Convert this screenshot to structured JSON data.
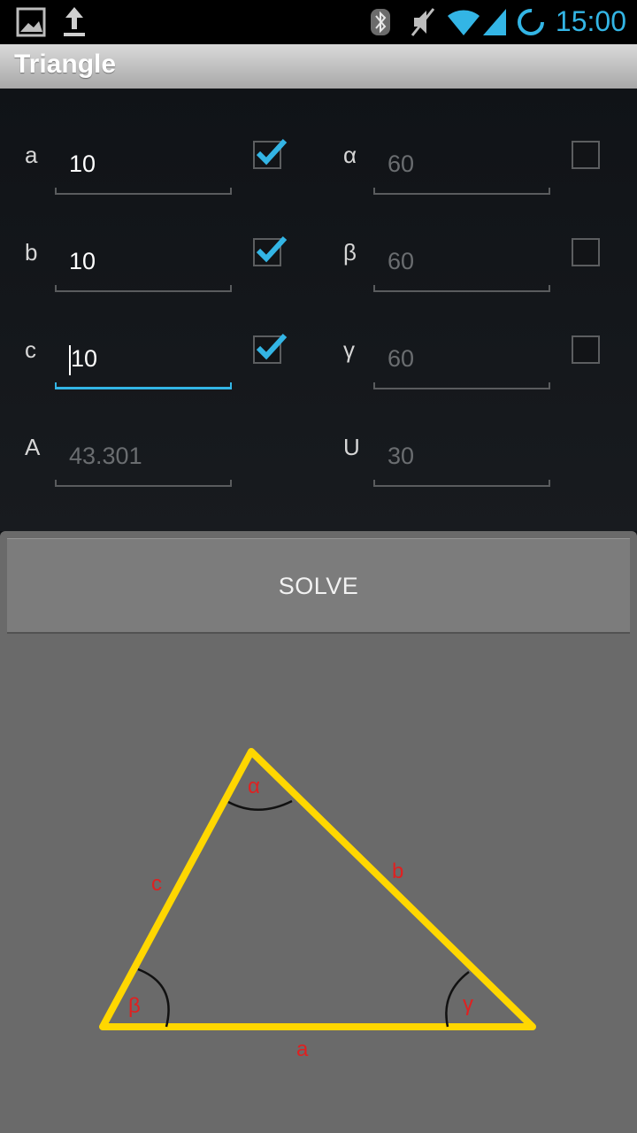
{
  "status_bar": {
    "time": "15:00",
    "icons": [
      "gallery-icon",
      "upload-icon",
      "bluetooth-icon",
      "mute-icon",
      "wifi-icon",
      "signal-icon",
      "sync-icon"
    ],
    "clock_color": "#33b5e5"
  },
  "app_bar": {
    "title": "Triangle"
  },
  "fields": {
    "a": {
      "label": "a",
      "value": "10",
      "checked": true
    },
    "alpha": {
      "label": "α",
      "value": "60",
      "checked": false
    },
    "b": {
      "label": "b",
      "value": "10",
      "checked": true
    },
    "beta": {
      "label": "β",
      "value": "60",
      "checked": false
    },
    "c": {
      "label": "c",
      "value": "10",
      "checked": true,
      "focused": true
    },
    "gamma": {
      "label": "γ",
      "value": "60",
      "checked": false
    },
    "area": {
      "label": "A",
      "value": "43.301"
    },
    "perimeter": {
      "label": "U",
      "value": "30"
    }
  },
  "solve_button": {
    "label": "SOLVE"
  },
  "diagram": {
    "side_labels": {
      "a": "a",
      "b": "b",
      "c": "c"
    },
    "angle_labels": {
      "alpha": "α",
      "beta": "β",
      "gamma": "γ"
    },
    "colors": {
      "triangle": "#ffd700",
      "labels": "#e02020",
      "arcs": "#111111"
    }
  },
  "colors": {
    "accent": "#33b5e5",
    "background": "#0d0f12",
    "panel": "#6a6a6a"
  }
}
